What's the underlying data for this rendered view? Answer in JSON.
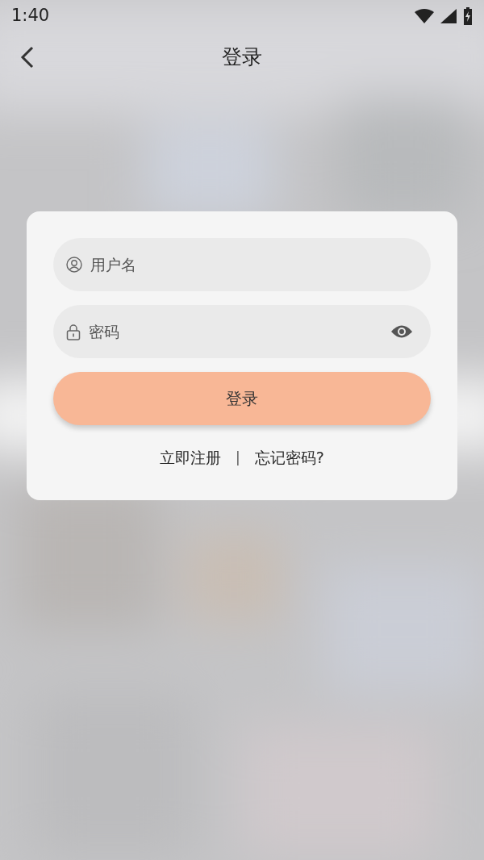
{
  "status_bar": {
    "time": "1:40"
  },
  "header": {
    "title": "登录"
  },
  "form": {
    "username": {
      "placeholder": "用户名"
    },
    "password": {
      "placeholder": "密码"
    },
    "submit": "登录",
    "links": [
      {
        "kind": "link",
        "label": "立即注册"
      },
      {
        "kind": "separator",
        "label": "|"
      },
      {
        "kind": "link",
        "label": "忘记密码?"
      }
    ]
  }
}
